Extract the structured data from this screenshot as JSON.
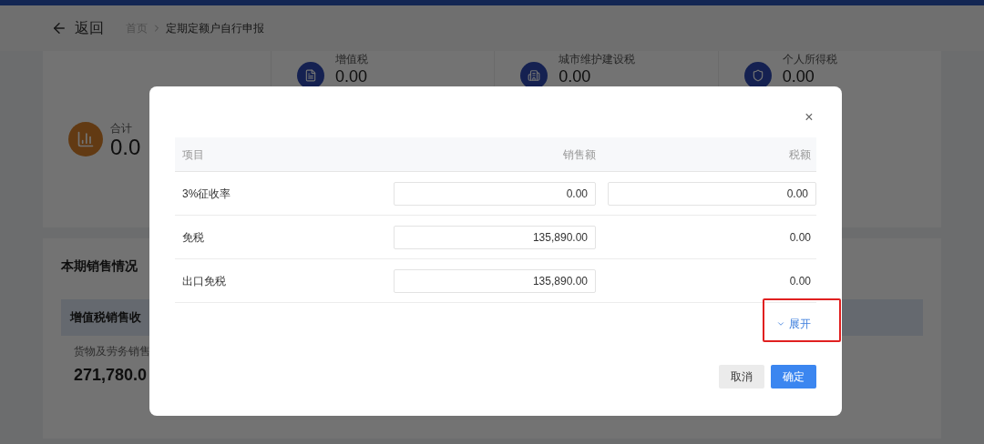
{
  "header": {
    "back": "返回",
    "breadcrumb": [
      "首页",
      "定期定额户自行申报"
    ]
  },
  "summary": {
    "total": {
      "label": "合计",
      "value": "0.0"
    },
    "taxes": [
      {
        "label": "增值税",
        "value": "0.00"
      },
      {
        "label": "城市维护建设税",
        "value": "0.00"
      },
      {
        "label": "个人所得税",
        "value": "0.00"
      }
    ]
  },
  "sales": {
    "title": "本期销售情况",
    "panel_title": "增值税销售收",
    "item_label": "货物及劳务销售",
    "item_value": "271,780.0"
  },
  "dialog": {
    "close": "×",
    "columns": [
      "项目",
      "销售额",
      "税额"
    ],
    "rows": [
      {
        "item": "3%征收率",
        "sales": "0.00",
        "tax": "0.00",
        "kind": "editable"
      },
      {
        "item": "免税",
        "sales": "135,890.00",
        "tax": "0.00",
        "kind": "readonly"
      },
      {
        "item": "出口免税",
        "sales": "135,890.00",
        "tax": "0.00",
        "kind": "readonly"
      }
    ],
    "expand": "展开",
    "highlight": true,
    "buttons": [
      {
        "label": "取消",
        "kind": "secondary"
      },
      {
        "label": "确定",
        "kind": "primary"
      }
    ]
  }
}
